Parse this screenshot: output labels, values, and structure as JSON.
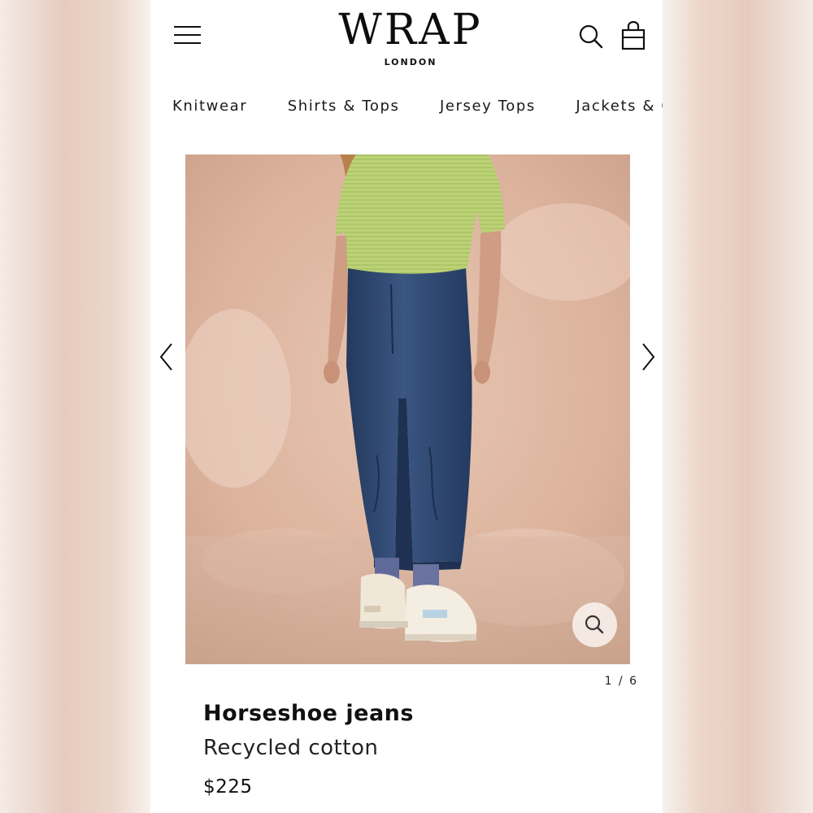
{
  "brand": {
    "name": "WRAP",
    "location": "LONDON"
  },
  "header": {
    "menu_icon": "hamburger-menu-icon",
    "search_icon": "search-icon",
    "bag_icon": "shopping-bag-icon"
  },
  "nav": {
    "items": [
      {
        "label": "Knitwear"
      },
      {
        "label": "Shirts & Tops"
      },
      {
        "label": "Jersey Tops"
      },
      {
        "label": "Jackets & C"
      }
    ]
  },
  "gallery": {
    "pager": "1 / 6",
    "prev_icon": "chevron-left-icon",
    "next_icon": "chevron-right-icon",
    "zoom_icon": "zoom-icon"
  },
  "product": {
    "title": "Horseshoe jeans",
    "subtitle": "Recycled cotton",
    "price": "$225"
  },
  "colors": {
    "text": "#111111",
    "backdrop": "#e2bca8",
    "top": "#b7cd6e",
    "denim": "#2f4a72"
  }
}
